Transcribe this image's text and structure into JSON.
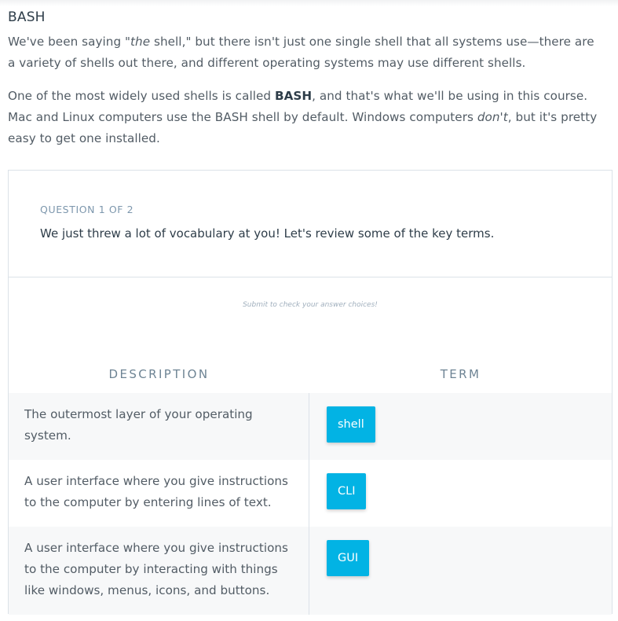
{
  "section": {
    "title": "BASH",
    "para1": {
      "a": "We've been saying \"",
      "em": "the",
      "b": " shell,\" but there isn't just one single shell that all systems use—there are a variety of shells out there, and different operating systems may use different shells."
    },
    "para2": {
      "a": "One of the most widely used shells is called ",
      "strong": "BASH",
      "b": ", and that's what we'll be using in this course. Mac and Linux computers use the BASH shell by default. Windows computers ",
      "em": "don't",
      "c": ", but it's pretty easy to get one installed."
    }
  },
  "quiz": {
    "count": "QUESTION 1 OF 2",
    "prompt": "We just threw a lot of vocabulary at you! Let's review some of the key terms.",
    "hint": "Submit to check your answer choices!",
    "headers": {
      "description": "DESCRIPTION",
      "term": "TERM"
    },
    "rows": [
      {
        "description": "The outermost layer of your operating system.",
        "term": "shell"
      },
      {
        "description": "A user interface where you give instructions to the computer by entering lines of text.",
        "term": "CLI"
      },
      {
        "description": "A user interface where you give instructions to the computer by interacting with things like windows, menus, icons, and buttons.",
        "term": "GUI"
      }
    ],
    "chip_color": "#02b3e4"
  }
}
